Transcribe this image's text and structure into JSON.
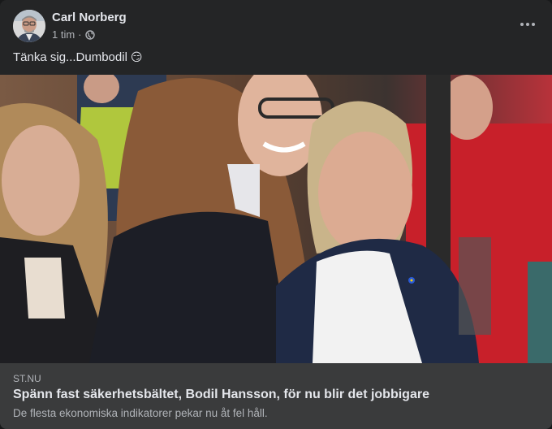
{
  "post": {
    "author": "Carl Norberg",
    "time": "1 tim",
    "separator": "·",
    "privacy_icon": "globe-icon",
    "text": "Tänka sig...Dumbodil",
    "emoji": "😏",
    "more_icon": "more-horizontal-icon"
  },
  "link": {
    "domain": "ST.NU",
    "title": "Spänn fast säkerhetsbältet, Bodil Hansson, för nu blir det jobbigare",
    "description": "De flesta ekonomiska indikatorer pekar nu åt fel håll."
  },
  "colors": {
    "card_bg": "#242526",
    "link_info_bg": "#3a3b3c",
    "primary_text": "#e4e6eb",
    "secondary_text": "#b0b3b8"
  }
}
